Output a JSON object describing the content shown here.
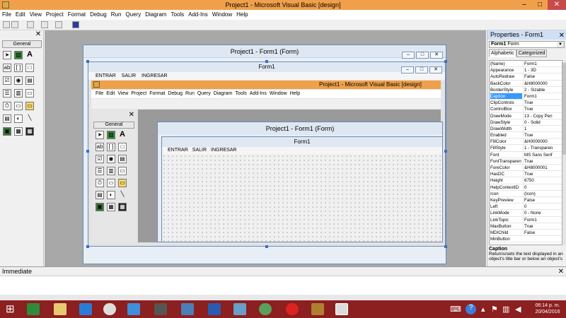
{
  "window": {
    "title": "Project1 - Microsoft Visual Basic [design]",
    "min": "–",
    "max": "□",
    "close": "✕"
  },
  "menu": [
    "File",
    "Edit",
    "View",
    "Project",
    "Format",
    "Debug",
    "Run",
    "Query",
    "Diagram",
    "Tools",
    "Add-Ins",
    "Window",
    "Help"
  ],
  "toolbox": {
    "close": "✕",
    "tab": "General",
    "tools": [
      "➤",
      "▧",
      "A",
      "ab",
      "[ ]",
      "□",
      "☑",
      "◉",
      "▤",
      "☰",
      "▥",
      "▭",
      "⏱",
      "▭",
      "▭",
      "▤",
      "◐",
      "╲",
      "▣",
      "▦",
      "▦"
    ]
  },
  "project_window": {
    "title": "Project1 - Form1 (Form)",
    "btn_min": "–",
    "btn_max": "□",
    "btn_close": "✕"
  },
  "form1": {
    "title": "Form1",
    "menu": [
      "ENTRAR",
      "SALIR",
      "INGRESAR"
    ]
  },
  "inner_window": {
    "title": "Project1 - Microsoft Visual Basic [design]",
    "menu": [
      "File",
      "Edit",
      "View",
      "Project",
      "Format",
      "Debug",
      "Run",
      "Query",
      "Diagram",
      "Tools",
      "Add-Ins",
      "Window",
      "Help"
    ],
    "toolbox_close": "✕",
    "toolbox_tab": "General",
    "project_title": "Project1 - Form1 (Form)",
    "form_title": "Form1",
    "form_menu": [
      "ENTRAR",
      "SALIR",
      "INGRESAR"
    ]
  },
  "properties": {
    "title": "Properties - Form1",
    "close": "✕",
    "object_name": "Form1",
    "object_type": "Form",
    "dropdown": "▼",
    "tab_alphabetic": "Alphabetic",
    "tab_categorized": "Categorized",
    "rows": [
      {
        "name": "(Name)",
        "value": "Form1"
      },
      {
        "name": "Appearance",
        "value": "1 - 3D"
      },
      {
        "name": "AutoRedraw",
        "value": "False"
      },
      {
        "name": "BackColor",
        "value": "&H8000000"
      },
      {
        "name": "BorderStyle",
        "value": "2 - Sizable"
      },
      {
        "name": "Caption",
        "value": "Form1"
      },
      {
        "name": "ClipControls",
        "value": "True"
      },
      {
        "name": "ControlBox",
        "value": "True"
      },
      {
        "name": "DrawMode",
        "value": "13 - Copy Pen"
      },
      {
        "name": "DrawStyle",
        "value": "0 - Solid"
      },
      {
        "name": "DrawWidth",
        "value": "1"
      },
      {
        "name": "Enabled",
        "value": "True"
      },
      {
        "name": "FillColor",
        "value": "&H0000000"
      },
      {
        "name": "FillStyle",
        "value": "1 - Transparen"
      },
      {
        "name": "Font",
        "value": "MS Sans Serif"
      },
      {
        "name": "FontTransparen",
        "value": "True"
      },
      {
        "name": "ForeColor",
        "value": "&H8000001"
      },
      {
        "name": "HasDC",
        "value": "True"
      },
      {
        "name": "Height",
        "value": "6750"
      },
      {
        "name": "HelpContextID",
        "value": "0"
      },
      {
        "name": "Icon",
        "value": "(Icon)"
      },
      {
        "name": "KeyPreview",
        "value": "False"
      },
      {
        "name": "Left",
        "value": "0"
      },
      {
        "name": "LinkMode",
        "value": "0 - None"
      },
      {
        "name": "LinkTopic",
        "value": "Form1"
      },
      {
        "name": "MaxButton",
        "value": "True"
      },
      {
        "name": "MDIChild",
        "value": "False"
      },
      {
        "name": "MinButton",
        "value": ""
      }
    ],
    "selected_index": 5,
    "desc_title": "Caption",
    "desc_text": "Returns/sets the text displayed in an object's title bar or below an object's"
  },
  "immediate": {
    "title": "Immediate",
    "close": "✕"
  },
  "taskbar": {
    "time": "06:14 p. m.",
    "date": "20/04/2016",
    "icons": [
      "windows-start",
      "excel",
      "files",
      "internet-explorer",
      "chrome",
      "dropbox",
      "app",
      "remote-desktop",
      "word",
      "generic",
      "dreamweaver",
      "flash",
      "misc",
      "vb6"
    ]
  },
  "colors": {
    "title_accent": "#f0a04a",
    "taskbar": "#8c1f1f",
    "selection": "#3399ff"
  }
}
